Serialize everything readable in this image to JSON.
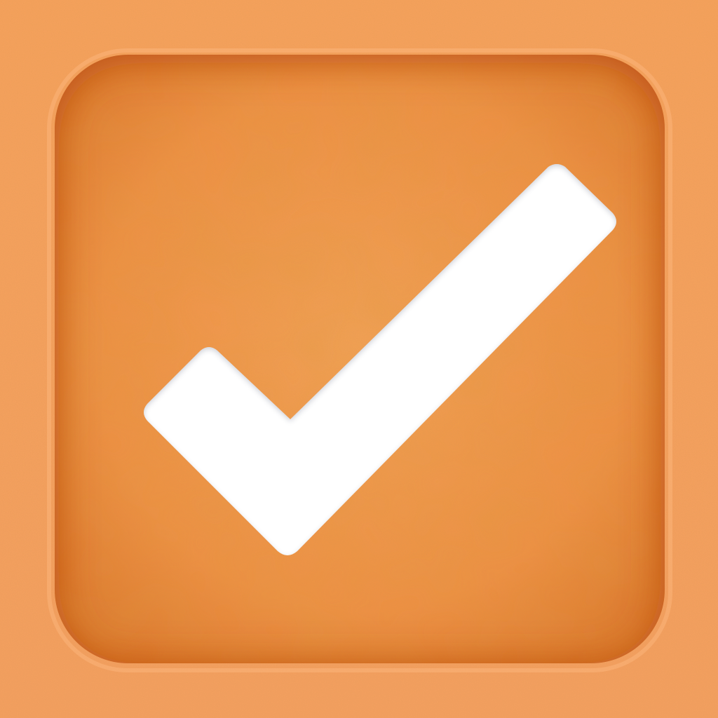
{
  "icon": {
    "semantic": "checkmark-icon",
    "colors": {
      "paper_outer": "#f7a05a",
      "paper_outer_light": "#f9ad6c",
      "well_fill": "#f0893a",
      "well_center": "#f59a4f",
      "well_edge_shadow": "#b84a10",
      "check_fill": "#ffffff",
      "check_shade": "#e4e6ec"
    }
  }
}
